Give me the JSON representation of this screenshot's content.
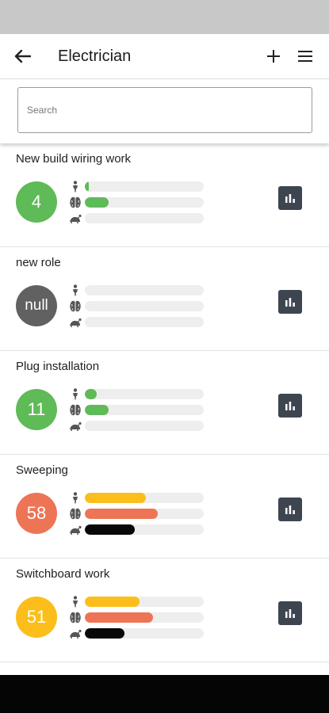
{
  "header": {
    "title": "Electrician"
  },
  "search": {
    "placeholder": "Search"
  },
  "colors": {
    "green": "#5fba58",
    "grey": "#616161",
    "orange": "#ed7555",
    "yellow": "#fbbe1a",
    "black": "#080808",
    "track": "#eeeeee",
    "chart_button": "#3d4650"
  },
  "icons": {
    "back": "arrow-left-icon",
    "add": "plus-icon",
    "menu": "hamburger-menu-icon",
    "metric_1": "person-icon",
    "metric_2": "brain-icon",
    "metric_3": "turtle-icon",
    "chart": "bar-chart-icon"
  },
  "roles": [
    {
      "name": "New build wiring work",
      "score": "4",
      "score_color": "green",
      "metrics": [
        {
          "value": 0.03,
          "color": "green"
        },
        {
          "value": 0.2,
          "color": "green"
        },
        {
          "value": 0,
          "color": "green"
        }
      ]
    },
    {
      "name": "new role",
      "score": "null",
      "score_color": "grey",
      "metrics": [
        {
          "value": 0,
          "color": "grey"
        },
        {
          "value": 0,
          "color": "grey"
        },
        {
          "value": 0,
          "color": "grey"
        }
      ]
    },
    {
      "name": "Plug installation",
      "score": "11",
      "score_color": "green",
      "metrics": [
        {
          "value": 0.1,
          "color": "green"
        },
        {
          "value": 0.2,
          "color": "green"
        },
        {
          "value": 0,
          "color": "green"
        }
      ]
    },
    {
      "name": "Sweeping",
      "score": "58",
      "score_color": "orange",
      "metrics": [
        {
          "value": 0.51,
          "color": "yellow"
        },
        {
          "value": 0.61,
          "color": "orange"
        },
        {
          "value": 0.42,
          "color": "black"
        }
      ]
    },
    {
      "name": "Switchboard work",
      "score": "51",
      "score_color": "yellow",
      "metrics": [
        {
          "value": 0.46,
          "color": "yellow"
        },
        {
          "value": 0.57,
          "color": "orange"
        },
        {
          "value": 0.33,
          "color": "black"
        }
      ]
    }
  ]
}
